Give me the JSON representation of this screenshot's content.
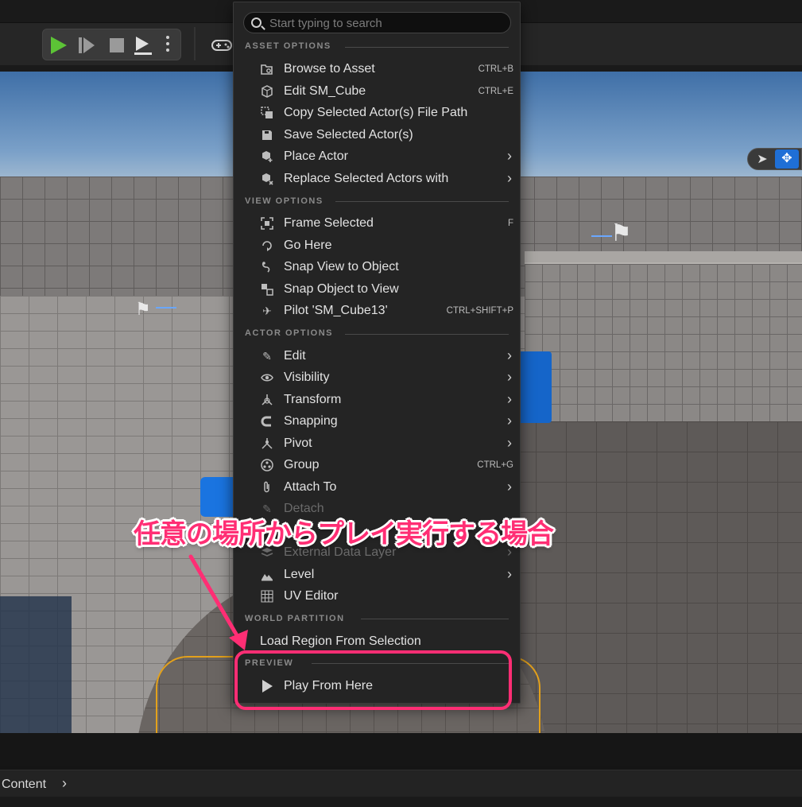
{
  "toolbar": {
    "play": "play-icon",
    "step": "step-icon",
    "stop": "stop-icon",
    "eject": "eject-icon",
    "more": "more-vertical-icon",
    "play_mode": "gamepad-icon"
  },
  "viewport": {
    "transform_select": "pointer-icon",
    "transform_move": "move-icon",
    "selection_color": "#e3a11c"
  },
  "context_menu": {
    "search": {
      "placeholder": "Start typing to search"
    },
    "sections": {
      "asset_options": "ASSET OPTIONS",
      "view_options": "VIEW OPTIONS",
      "actor_options": "ACTOR OPTIONS",
      "world_partition": "WORLD PARTITION",
      "preview": "PREVIEW"
    },
    "items": {
      "browse_to_asset": {
        "label": "Browse to Asset",
        "shortcut": "CTRL+B"
      },
      "edit_sm_cube": {
        "label": "Edit SM_Cube",
        "shortcut": "CTRL+E"
      },
      "copy_file_path": {
        "label": "Copy Selected Actor(s) File Path"
      },
      "save_selected": {
        "label": "Save Selected Actor(s)"
      },
      "place_actor": {
        "label": "Place Actor"
      },
      "replace_actors": {
        "label": "Replace Selected Actors with"
      },
      "frame_selected": {
        "label": "Frame Selected",
        "shortcut": "F"
      },
      "go_here": {
        "label": "Go Here"
      },
      "snap_view": {
        "label": "Snap View to Object"
      },
      "snap_object": {
        "label": "Snap Object to View"
      },
      "pilot": {
        "label": "Pilot 'SM_Cube13'",
        "shortcut": "CTRL+SHIFT+P"
      },
      "edit": {
        "label": "Edit"
      },
      "visibility": {
        "label": "Visibility"
      },
      "transform": {
        "label": "Transform"
      },
      "snapping": {
        "label": "Snapping"
      },
      "pivot": {
        "label": "Pivot"
      },
      "group": {
        "label": "Group",
        "shortcut": "CTRL+G"
      },
      "attach_to": {
        "label": "Attach To"
      },
      "detach": {
        "label": "Detach"
      },
      "external_data_layer": {
        "label": "External Data Layer"
      },
      "level": {
        "label": "Level"
      },
      "uv_editor": {
        "label": "UV Editor"
      },
      "load_region": {
        "label": "Load Region From Selection"
      },
      "play_from_here": {
        "label": "Play From Here"
      }
    }
  },
  "annotation": {
    "text": "任意の場所からプレイ実行する場合",
    "color": "#ff2e74"
  },
  "content_browser": {
    "label": "Content"
  },
  "colors": {
    "menu_bg": "#242424",
    "play_green": "#5cc336",
    "accent_blue": "#1f6fd6"
  }
}
